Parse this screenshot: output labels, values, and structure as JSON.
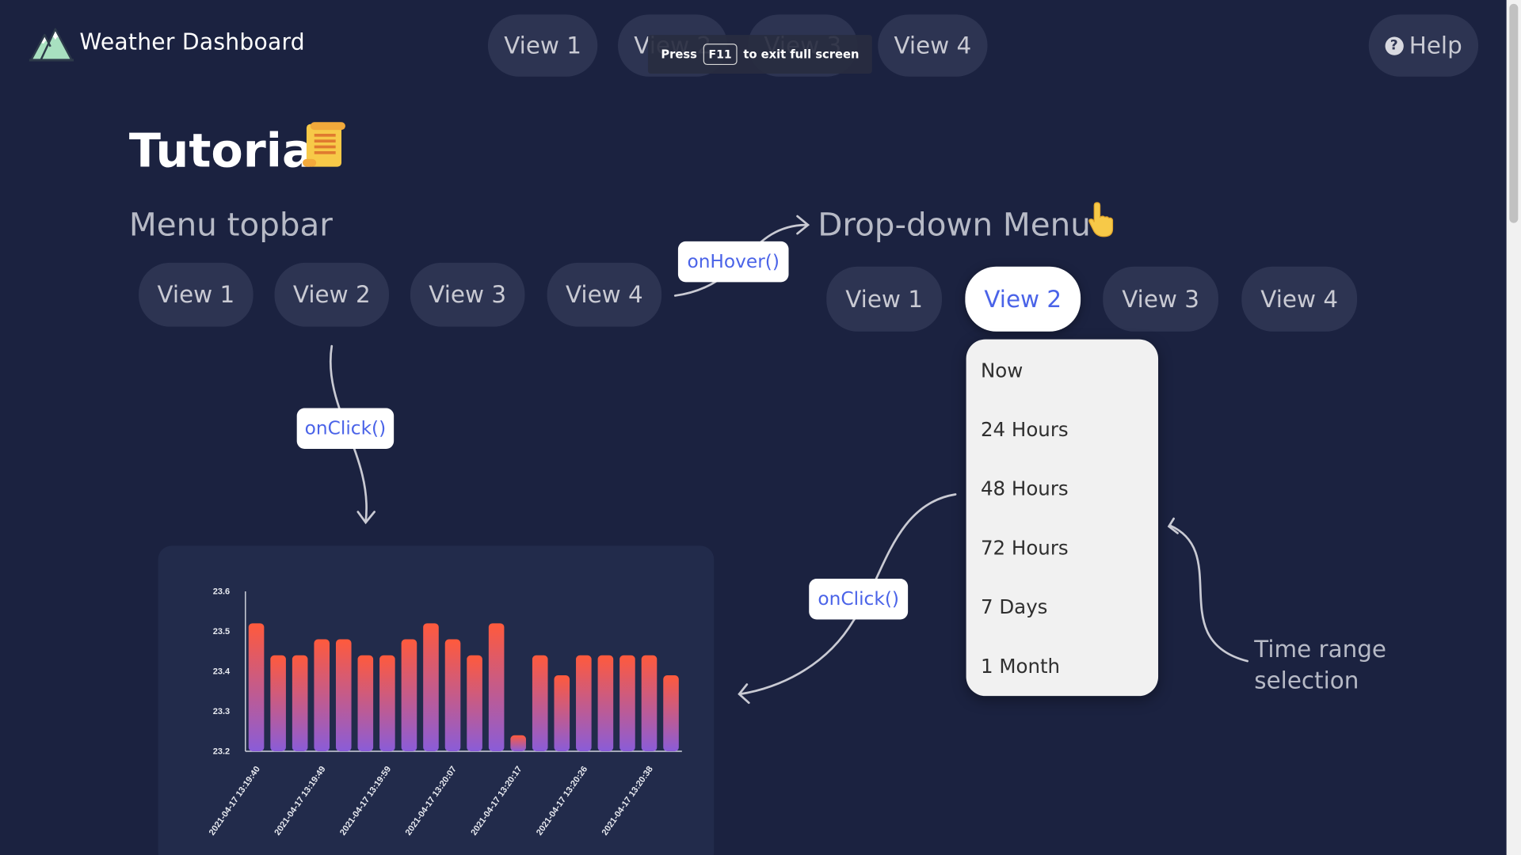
{
  "app": {
    "title": "Weather Dashboard"
  },
  "topnav": {
    "items": [
      {
        "label": "View 1"
      },
      {
        "label": "View 2"
      },
      {
        "label": "View 3"
      },
      {
        "label": "View 4"
      }
    ],
    "help_label": "Help"
  },
  "fullscreen_notice": {
    "before": "Press",
    "key": "F11",
    "after": "to exit full screen"
  },
  "page": {
    "title": "Tutorial"
  },
  "menu_topbar": {
    "title": "Menu topbar",
    "items": [
      {
        "label": "View 1"
      },
      {
        "label": "View 2"
      },
      {
        "label": "View 3"
      },
      {
        "label": "View 4"
      }
    ]
  },
  "dropdown": {
    "title": "Drop-down Menu",
    "items": [
      {
        "label": "View 1"
      },
      {
        "label": "View 2"
      },
      {
        "label": "View 3"
      },
      {
        "label": "View 4"
      }
    ],
    "active_index": 1,
    "options": [
      {
        "label": "Now"
      },
      {
        "label": "24 Hours"
      },
      {
        "label": "48 Hours"
      },
      {
        "label": "72 Hours"
      },
      {
        "label": "7 Days"
      },
      {
        "label": "1 Month"
      }
    ]
  },
  "annotations": {
    "hover": "onHover()",
    "click_topbar": "onClick()",
    "click_dropdown": "onClick()",
    "time_range_line1": "Time range",
    "time_range_line2": "selection"
  },
  "icons": {
    "logo": "mountain-icon",
    "tutorial": "scroll-icon",
    "dropdown": "pointing-hand-icon",
    "help": "question-circle-icon"
  },
  "colors": {
    "background": "#1b2240",
    "pill": "#2d3452",
    "accent": "#4a63e8",
    "bar_top": "#ff5a3c",
    "bar_bottom": "#8a5cd8"
  },
  "chart_data": {
    "type": "bar",
    "ylim": [
      23.2,
      23.6
    ],
    "yticks": [
      23.2,
      23.3,
      23.4,
      23.5,
      23.6
    ],
    "values": [
      23.52,
      23.44,
      23.44,
      23.48,
      23.48,
      23.44,
      23.44,
      23.48,
      23.52,
      23.48,
      23.44,
      23.52,
      23.24,
      23.44,
      23.39,
      23.44,
      23.44,
      23.44,
      23.44,
      23.39
    ],
    "x_tick_labels": [
      "2021-04-17 13:19:40",
      "2021-04-17 13:19:49",
      "2021-04-17 13:19:59",
      "2021-04-17 13:20:07",
      "2021-04-17 13:20:17",
      "2021-04-17 13:20:26",
      "2021-04-17 13:20:38"
    ],
    "grid": false
  }
}
